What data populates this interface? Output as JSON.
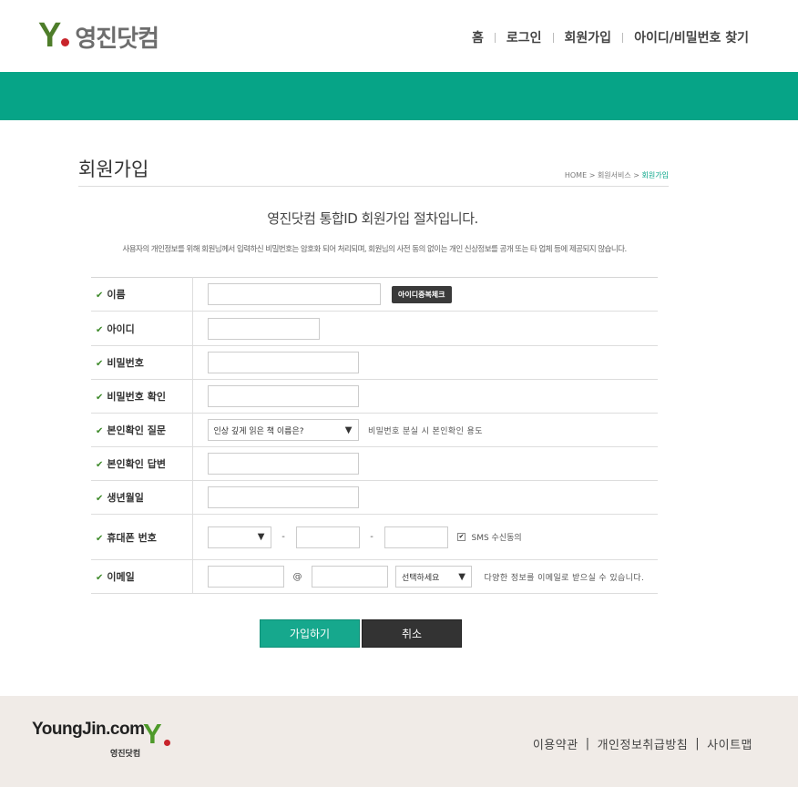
{
  "header": {
    "logo_letter": "Y",
    "logo_text": "영진닷컴",
    "nav": [
      "홈",
      "로그인",
      "회원가입",
      "아이디/비밀번호 찾기"
    ]
  },
  "page": {
    "title": "회원가입",
    "breadcrumb": [
      "HOME",
      "회원서비스",
      "회원가입"
    ],
    "breadcrumb_sep": ">",
    "headline": "영진닷컴 통합ID 회원가입 절차입니다.",
    "notice": "사용자의 개인정보를 위해 회원님께서 입력하신 비밀번호는 암호화 되어 처리되며, 회원님의 사전 동의 없이는 개인 신상정보를 공개 또는 타 업체 등에 제공되지 않습니다."
  },
  "form": {
    "check_icon": "✔",
    "name_label": "이름",
    "dup_check_button": "아이디중복체크",
    "id_label": "아이디",
    "password_label": "비밀번호",
    "password_confirm_label": "비밀번호 확인",
    "question_label": "본인확인 질문",
    "question_selected": "인상 깊게 읽은 책 이름은?",
    "question_hint": "비밀번호 분실 시 본인확인 용도",
    "answer_label": "본인확인 답변",
    "birth_label": "생년월일",
    "phone_label": "휴대폰 번호",
    "phone_sep": "-",
    "sms_label": "SMS 수신동의",
    "sms_checked": true,
    "email_label": "이메일",
    "email_at": "@",
    "email_domain_selected": "선택하세요",
    "email_hint": "다양한 정보를 이메일로 받으실 수 있습니다."
  },
  "actions": {
    "join": "가입하기",
    "cancel": "취소"
  },
  "footer": {
    "logo_text": "YoungJin.com",
    "logo_letter": "Y",
    "logo_sub": "영진닷컴",
    "links": [
      "이용약관",
      "개인정보취급방침",
      "사이트맵"
    ],
    "sep": "|"
  },
  "colors": {
    "brand_green": "#06a487",
    "logo_green": "#4e7d2a",
    "logo_red": "#c8242b",
    "footer_bg": "#f0ebe7"
  }
}
